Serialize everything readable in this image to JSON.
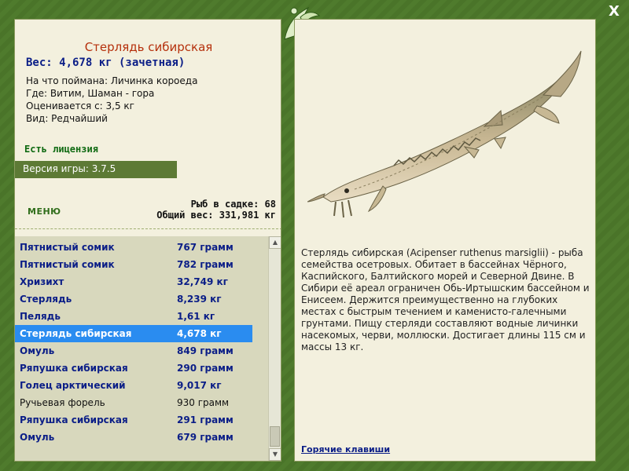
{
  "fish": {
    "title": "Стерлядь сибирская",
    "weight": "Вес: 4,678 кг (зачетная)",
    "bait": "На что поймана: Личинка короеда",
    "location": "Где: Витим, Шаман - гора",
    "rated_from": "Оценивается с: 3,5 кг",
    "kind": "Вид: Редчайший"
  },
  "license": "Есть лицензия",
  "version": "Версия игры: 3.7.5",
  "menu_label": "МЕНЮ",
  "stats": {
    "fish_in_keepnet": "Рыб в садке: 68",
    "total_weight": "Общий вес: 331,981 кг"
  },
  "catch_list": [
    {
      "name": "Пятнистый сомик",
      "weight": "767 грамм"
    },
    {
      "name": "Пятнистый сомик",
      "weight": "782 грамм"
    },
    {
      "name": "Хризихт",
      "weight": "32,749 кг"
    },
    {
      "name": "Стерлядь",
      "weight": "8,239 кг"
    },
    {
      "name": "Пелядь",
      "weight": "1,61 кг"
    },
    {
      "name": "Стерлядь сибирская",
      "weight": "4,678 кг"
    },
    {
      "name": "Омуль",
      "weight": "849 грамм"
    },
    {
      "name": "Ряпушка сибирская",
      "weight": "290 грамм"
    },
    {
      "name": "Голец арктический",
      "weight": "9,017 кг"
    },
    {
      "name": "Ручьевая форель",
      "weight": "930 грамм"
    },
    {
      "name": "Ряпушка сибирская",
      "weight": "291 грамм"
    },
    {
      "name": "Омуль",
      "weight": "679 грамм"
    }
  ],
  "description": "Стерлядь сибирская (Acipenser ruthenus marsiglii) - рыба семейства осетровых. Обитает в бассейнах Чёрного, Каспийского, Балтийского морей и Северной Двине. В Сибири её ареал ограничен Обь-Иртышским бассейном и Енисеем. Держится преимущественно на глубоких местах с быстрым течением и каменисто-галечными грунтами. Пищу стерляди составляют водные личинки насекомых, черви, моллюски. Достигает длины 115 см и массы 13 кг.",
  "hotkeys": "Горячие клавиши",
  "close_label": "X",
  "icons": {
    "close": "close-icon",
    "logo": "fish-leaf-logo-icon",
    "scroll_up": "scroll-up-arrow-icon",
    "scroll_down": "scroll-down-arrow-icon"
  },
  "colors": {
    "frame": "#4e7a2c",
    "panel": "#f3f0de",
    "title": "#b5300c",
    "link_blue": "#0b1e87",
    "license_green": "#0f6a12",
    "selection": "#2a8cf0",
    "list_bg": "#d8d8bd"
  }
}
